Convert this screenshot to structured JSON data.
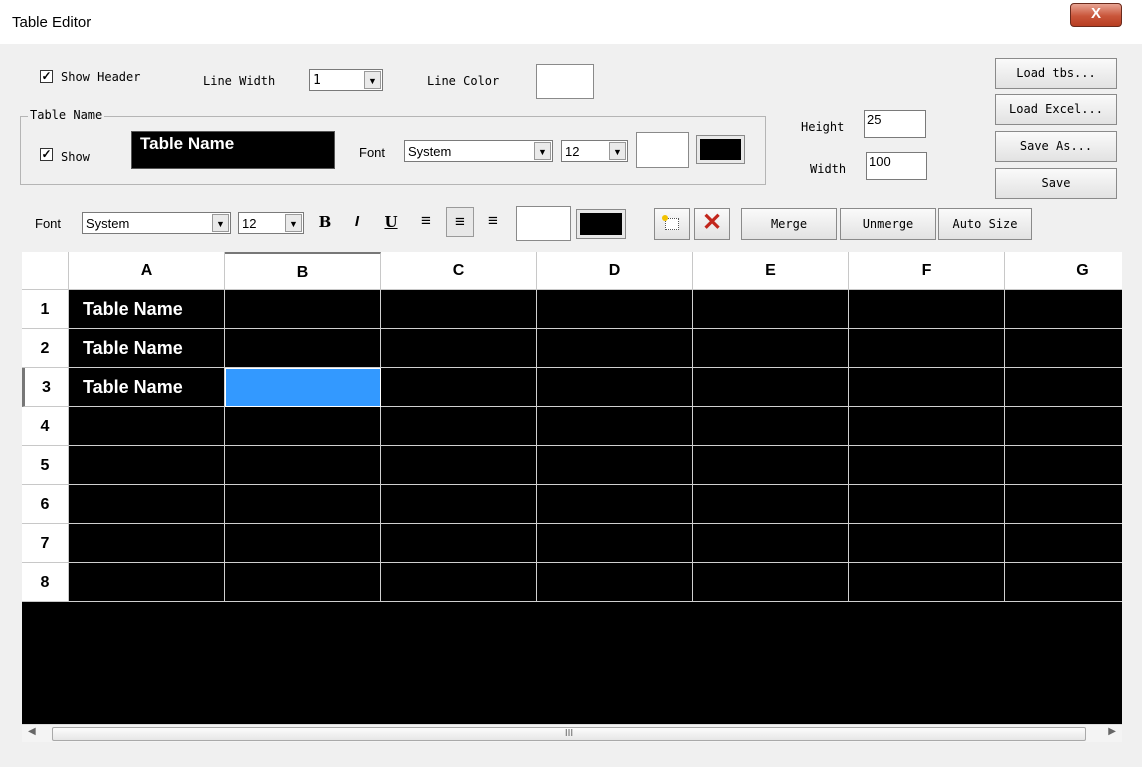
{
  "window": {
    "title": "Table Editor",
    "close_label": "X"
  },
  "header_opts": {
    "show_header_label": "Show Header",
    "show_header_checked": true,
    "line_width_label": "Line Width",
    "line_width_value": "1",
    "line_color_label": "Line Color",
    "line_color": "#ffffff"
  },
  "table_name_group": {
    "label": "Table Name",
    "show_label": "Show",
    "show_checked": true,
    "preview_text": "Table Name",
    "font_label": "Font",
    "font_value": "System",
    "size_value": "12",
    "bg_color": "#ffffff",
    "fg_color": "#000000"
  },
  "dimensions": {
    "height_label": "Height",
    "height_value": "25",
    "width_label": "Width",
    "width_value": "100"
  },
  "side_buttons": {
    "load_tbs": "Load tbs...",
    "load_excel": "Load Excel...",
    "save_as": "Save As...",
    "save": "Save"
  },
  "format_bar": {
    "font_label": "Font",
    "font_value": "System",
    "size_value": "12",
    "bold": "B",
    "italic": "I",
    "underline": "U",
    "bg_color": "#ffffff",
    "fg_color": "#000000",
    "merge": "Merge",
    "unmerge": "Unmerge",
    "auto_size": "Auto Size"
  },
  "grid": {
    "columns": [
      "A",
      "B",
      "C",
      "D",
      "E",
      "F",
      "G"
    ],
    "rows": [
      "1",
      "2",
      "3",
      "4",
      "5",
      "6",
      "7",
      "8"
    ],
    "cells": [
      [
        "Table Name",
        "",
        "",
        "",
        "",
        "",
        ""
      ],
      [
        "Table Name",
        "",
        "",
        "",
        "",
        "",
        ""
      ],
      [
        "Table Name",
        "",
        "",
        "",
        "",
        "",
        ""
      ],
      [
        "",
        "",
        "",
        "",
        "",
        "",
        ""
      ],
      [
        "",
        "",
        "",
        "",
        "",
        "",
        ""
      ],
      [
        "",
        "",
        "",
        "",
        "",
        "",
        ""
      ],
      [
        "",
        "",
        "",
        "",
        "",
        "",
        ""
      ],
      [
        "",
        "",
        "",
        "",
        "",
        "",
        ""
      ]
    ],
    "selected_column": "B",
    "selected_row": "3",
    "cell_bg": "#000000",
    "cell_fg": "#ffffff",
    "selection_color": "#3399ff"
  },
  "scrollbar": {
    "grip": "III"
  }
}
